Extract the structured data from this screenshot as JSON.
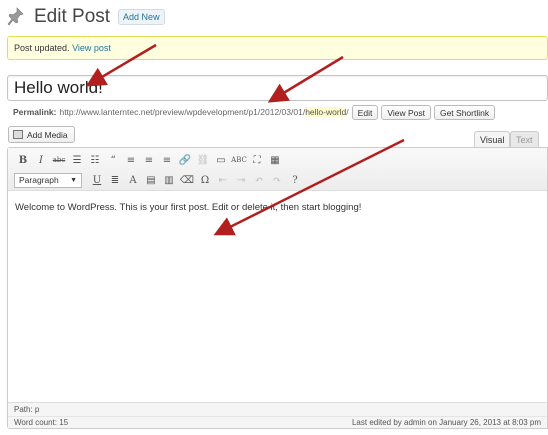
{
  "header": {
    "title": "Edit Post",
    "add_new_label": "Add New"
  },
  "notice": {
    "text": "Post updated.",
    "link": "View post"
  },
  "post": {
    "title": "Hello world!"
  },
  "permalink": {
    "label": "Permalink:",
    "base_url": "http://www.lanterntec.net/preview/wpdevelopment/p1/2012/03/01/",
    "slug": "hello-world",
    "trailing": "/",
    "buttons": {
      "edit": "Edit",
      "view_post": "View Post",
      "shortlink": "Get Shortlink"
    }
  },
  "media": {
    "add_media_label": "Add Media"
  },
  "tabs": {
    "visual": "Visual",
    "text": "Text"
  },
  "toolbar": {
    "row1": [
      {
        "glyph": "B",
        "name": "bold"
      },
      {
        "glyph": "I",
        "name": "italic"
      },
      {
        "glyph": "abc",
        "name": "strikethrough"
      },
      {
        "glyph": "☰",
        "name": "bulleted-list"
      },
      {
        "glyph": "☷",
        "name": "numbered-list"
      },
      {
        "glyph": "“",
        "name": "blockquote"
      },
      {
        "glyph": "≡",
        "name": "align-left"
      },
      {
        "glyph": "≡",
        "name": "align-center"
      },
      {
        "glyph": "≡",
        "name": "align-right"
      },
      {
        "glyph": "🔗",
        "name": "insert-link"
      },
      {
        "glyph": "⛓",
        "name": "unlink"
      },
      {
        "glyph": "▭",
        "name": "insert-more"
      },
      {
        "glyph": "ABC",
        "name": "spellcheck"
      },
      {
        "glyph": "⛶",
        "name": "fullscreen"
      },
      {
        "glyph": "▦",
        "name": "kitchen-sink"
      }
    ],
    "format_select": "Paragraph",
    "row2": [
      {
        "glyph": "U",
        "name": "underline"
      },
      {
        "glyph": "≣",
        "name": "justify"
      },
      {
        "glyph": "A",
        "name": "text-color"
      },
      {
        "glyph": "▤",
        "name": "paste-text"
      },
      {
        "glyph": "▥",
        "name": "paste-word"
      },
      {
        "glyph": "⌫",
        "name": "clear-formatting"
      },
      {
        "glyph": "Ω",
        "name": "special-character"
      },
      {
        "glyph": "⇤",
        "name": "outdent"
      },
      {
        "glyph": "⇥",
        "name": "indent"
      },
      {
        "glyph": "↶",
        "name": "undo"
      },
      {
        "glyph": "↷",
        "name": "redo"
      },
      {
        "glyph": "?",
        "name": "help"
      }
    ]
  },
  "editor": {
    "content": "Welcome to WordPress. This is your first post. Edit or delete it, then start blogging!",
    "path": "Path: p",
    "word_count": "Word count: 15",
    "last_edited": "Last edited by admin on January 26, 2013 at 8:03 pm"
  },
  "colors": {
    "arrow": "#b21f1f",
    "notice_bg": "#ffffe0",
    "link": "#21759b"
  }
}
